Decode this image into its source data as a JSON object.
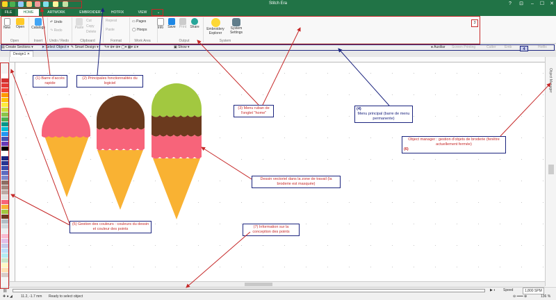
{
  "window": {
    "title": "Stitch Era",
    "help": "?",
    "minimize": "–",
    "maximize": "☐",
    "close": "✕"
  },
  "tabs": [
    "FILE",
    "HOME",
    "ARTWORK",
    "EMBROIDERY",
    "HOTFIX",
    "VIEW"
  ],
  "ribbon": {
    "buttons": {
      "new": "New",
      "open": "Open",
      "catalogs": "Catalogs",
      "undo": "Undo",
      "redo": "Redo",
      "paste": "Paste",
      "cut": "Cut",
      "copy": "Copy",
      "delete": "Delete",
      "repeat": "Repeat",
      "paste2": "Paste",
      "pages": "Pages",
      "hoops": "Hoops",
      "info": "Info",
      "save": "Save",
      "print": "Print",
      "share": "Share",
      "explorer": "Embroidery Explorer",
      "settings": "System Settings"
    },
    "groups": {
      "open": "Open",
      "insert": "Insert",
      "undo_redo": "Undo / Redo",
      "clipboard": "Clipboard",
      "format": "Format",
      "work_area": "Work Area",
      "output": "Output",
      "system": "System"
    }
  },
  "toolbar": {
    "create_sections": "Create Sections",
    "select_object": "Select Object",
    "smart_design": "Smart Design",
    "show": "Show",
    "auxiliar": "Auxiliar",
    "screen_printing": "Screen Printing",
    "cutter": "Cutter",
    "embroidery_short": "Emb",
    "hotfix": "Hotfix"
  },
  "document_tab": "Design1",
  "right_panel_label": "Object Manager",
  "status": {
    "coords": "11.2, -1.7 mm",
    "message": "Ready to select object",
    "speed_label": "Speed",
    "speed_value": "1,800 SPM",
    "zoom": "136 %"
  },
  "annotations": {
    "a1": "(1) Barre d'accès rapide",
    "a2": "(2) Principales fonctionnalités du logiciel",
    "a3": "(3) Menu ruban de l'onglet \"home\"",
    "a4_num": "(4)",
    "a4": "Menu principal (barre de menu permanente)",
    "a5": "(5) Gestion des couleurs : couleurs du dessin et couleur des points",
    "a6": "Object manager : gestion d'objets de broderie (fenêtre actuellement fermée)",
    "a6_num": "(6)",
    "a7": "(7) Information sur la conception des points",
    "vec": "Dessin vectoriel dans la zone de travail (la broderie est masquée)",
    "label3": "3",
    "label4": "4"
  },
  "colors": {
    "green": "#217346",
    "cone": "#f9b233",
    "pink": "#f7647a",
    "chocolate": "#6b3a1e",
    "lime": "#a2c840",
    "annotation_red": "#c62828",
    "annotation_blue": "#1a237e"
  }
}
